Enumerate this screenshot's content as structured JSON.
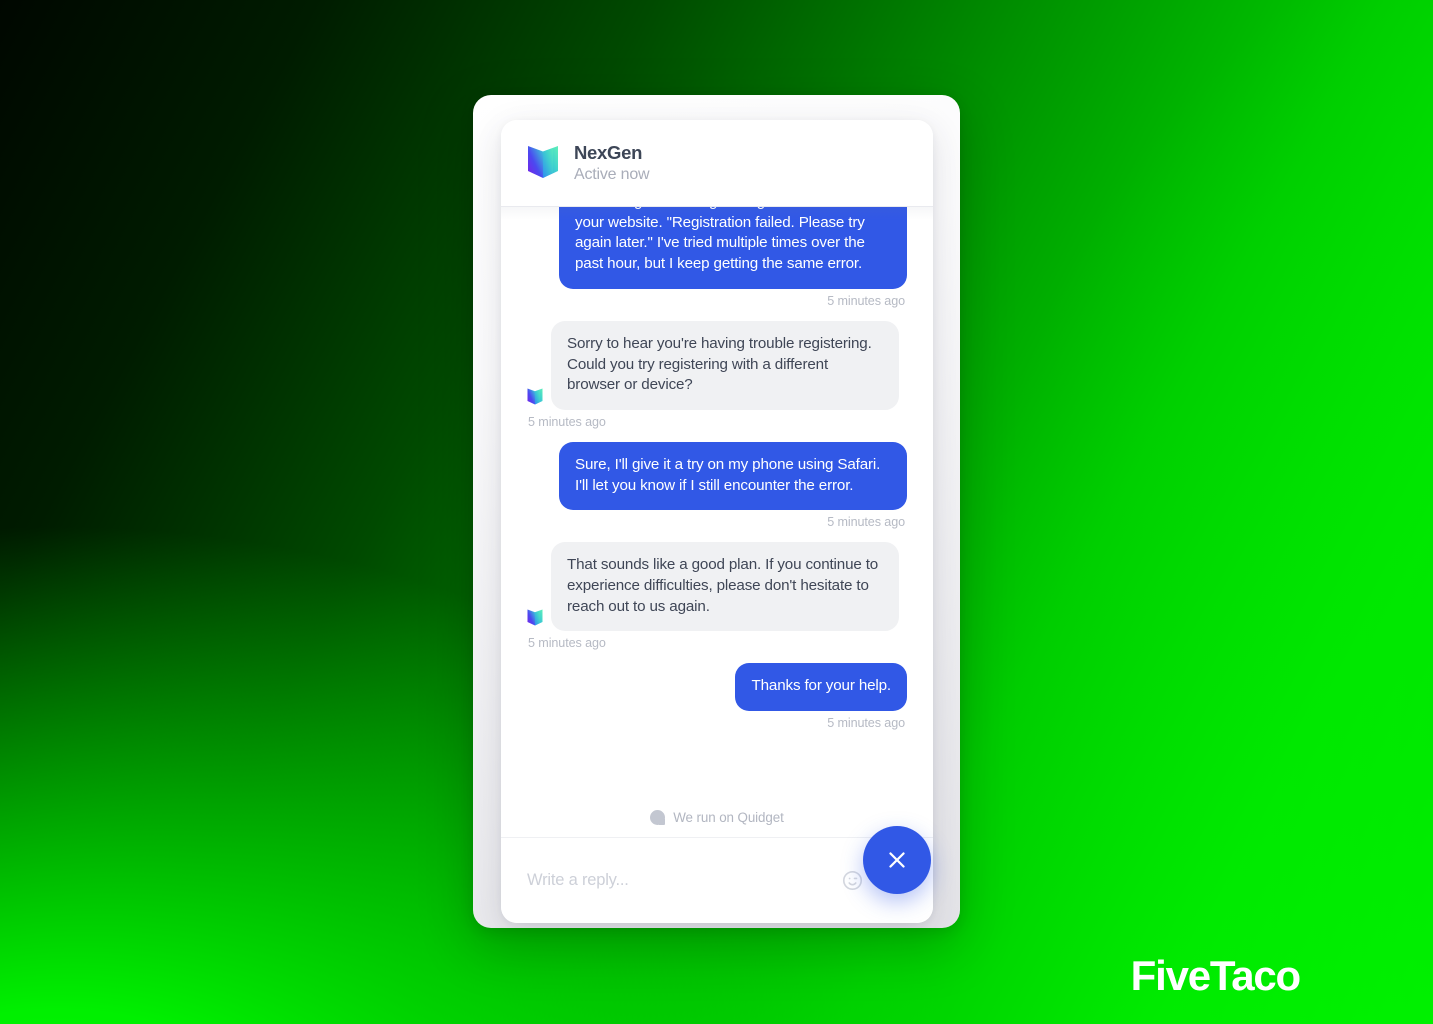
{
  "header": {
    "brand_name": "NexGen",
    "status": "Active now",
    "logo_icon": "book-logo-icon"
  },
  "conversation": [
    {
      "sender": "user",
      "text": "I'm having trouble registering for an account on your website. \"Registration failed. Please try again later.\" I've tried multiple times over the past hour, but I keep getting the same error.",
      "time": "5 minutes ago"
    },
    {
      "sender": "agent",
      "text": "Sorry to hear you're having trouble registering. Could you try registering with a different browser or device?",
      "time": "5 minutes ago"
    },
    {
      "sender": "user",
      "text": "Sure, I'll give it a try on my phone using Safari. I'll let you know if I still encounter the error.",
      "time": "5 minutes ago"
    },
    {
      "sender": "agent",
      "text": "That sounds like a good plan. If you continue to experience difficulties, please don't hesitate to reach out to us again.",
      "time": "5 minutes ago"
    },
    {
      "sender": "user",
      "text": "Thanks for your help.",
      "time": "5 minutes ago"
    }
  ],
  "powered_by": {
    "label": "We run on Quidget",
    "icon": "quidget-bubble-icon"
  },
  "composer": {
    "placeholder": "Write a reply...",
    "value": "",
    "emoji_icon": "wink-smiley-icon",
    "attach_icon": "paperclip-icon"
  },
  "close_button": {
    "icon": "close-x-icon",
    "label": "Close chat"
  },
  "watermark": {
    "text": "FiveTaco"
  },
  "colors": {
    "accent_blue": "#3158e6",
    "agent_bubble": "#f0f1f3",
    "agent_text": "#3f4656",
    "timestamp": "#b6bac4",
    "background_green": "#00ee00",
    "background_dark": "#000700"
  }
}
